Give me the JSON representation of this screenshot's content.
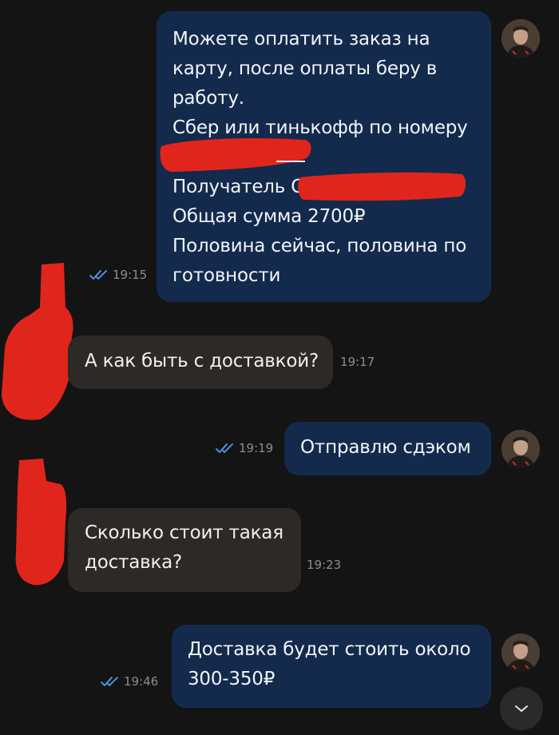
{
  "messages": [
    {
      "direction": "outgoing",
      "lines": [
        "Можете оплатить заказ на",
        "карту, после оплаты беру в",
        "работу.",
        "Сбер или тинькофф по номеру",
        "",
        "Получатель О",
        "Общая сумма 2700₽",
        "Половина сейчас, половина по",
        "готовности"
      ],
      "time": "19:15",
      "status": "read"
    },
    {
      "direction": "incoming",
      "lines": [
        "А как быть с доставкой?"
      ],
      "time": "19:17"
    },
    {
      "direction": "outgoing",
      "lines": [
        "Отправлю сдэком"
      ],
      "time": "19:19",
      "status": "read"
    },
    {
      "direction": "incoming",
      "lines": [
        "Сколько стоит такая",
        "доставка?"
      ],
      "time": "19:23"
    },
    {
      "direction": "outgoing",
      "lines": [
        "Доставка будет стоить около",
        "300-350₽"
      ],
      "time": "19:46",
      "status": "read"
    }
  ],
  "icons": {
    "read_receipt": "double-check-icon",
    "scroll_down": "chevron-down-icon",
    "avatar": "user-avatar"
  },
  "colors": {
    "background": "#141415",
    "outgoing_bubble": "#132a4c",
    "incoming_bubble": "#2d2a26",
    "read_check": "#4f9cf0",
    "redaction": "#e0261c"
  }
}
